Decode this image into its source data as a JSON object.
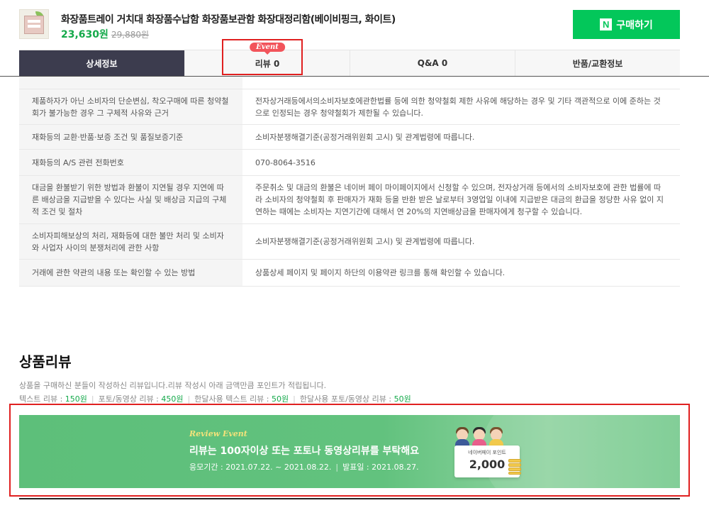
{
  "product": {
    "title": "화장품트레이 거치대 화장품수납함 화장품보관함 화장대정리함(베이비핑크, 화이트)",
    "price": "23,630원",
    "original_price": "29,880원",
    "buy_label": "구매하기",
    "buy_logo": "N"
  },
  "tabs": [
    {
      "label": "상세정보",
      "active": true
    },
    {
      "label": "리뷰 0",
      "badge": "Event"
    },
    {
      "label": "Q&A 0"
    },
    {
      "label": "반품/교환정보"
    }
  ],
  "info_rows": [
    {
      "key": "",
      "value": ""
    },
    {
      "key": "제품하자가 아닌 소비자의 단순변심, 착오구매에 따른 청약철회가 불가능한 경우 그 구체적 사유와 근거",
      "value": "전자상거래등에서의소비자보호에관한법률 등에 의한 청약철회 제한 사유에 해당하는 경우 및 기타 객관적으로 이에 준하는 것으로 인정되는 경우 청약철회가 제한될 수 있습니다."
    },
    {
      "key": "재화등의 교환·반품·보증 조건 및 품질보증기준",
      "value": "소비자분쟁해결기준(공정거래위원회 고시) 및 관계법령에 따릅니다."
    },
    {
      "key": "재화등의 A/S 관련 전화번호",
      "value": "070-8064-3516"
    },
    {
      "key": "대금을 환불받기 위한 방법과 환불이 지연될 경우 지연에 따른 배상금을 지급받을 수 있다는 사실 및 배상금 지급의 구체적 조건 및 절차",
      "value": "주문취소 및 대금의 환불은 네이버 페이 마이페이지에서 신청할 수 있으며, 전자상거래 등에서의 소비자보호에 관한 법률에 따라 소비자의 청약철회 후 판매자가 재화 등을 반환 받은 날로부터 3영업일 이내에 지급받은 대금의 환급을 정당한 사유 없이 지연하는 때에는 소비자는 지연기간에 대해서 연 20%의 지연배상금을 판매자에게 청구할 수 있습니다."
    },
    {
      "key": "소비자피해보상의 처리, 재화등에 대한 불만 처리 및 소비자와 사업자 사이의 분쟁처리에 관한 사항",
      "value": "소비자분쟁해결기준(공정거래위원회 고시) 및 관계법령에 따릅니다."
    },
    {
      "key": "거래에 관한 약관의 내용 또는 확인할 수 있는 방법",
      "value": "상품상세 페이지 및 페이지 하단의 이용약관 링크를 통해 확인할 수 있습니다."
    }
  ],
  "review": {
    "title": "상품리뷰",
    "description": "상품을 구매하신 분들이 작성하신 리뷰입니다.리뷰 작성시 아래 금액만큼 포인트가 적립됩니다.",
    "points": [
      {
        "label": "텍스트 리뷰 : ",
        "value": "150원"
      },
      {
        "label": "포토/동영상 리뷰 : ",
        "value": "450원"
      },
      {
        "label": "한달사용 텍스트 리뷰 : ",
        "value": "50원"
      },
      {
        "label": "한달사용 포토/동영상 리뷰 : ",
        "value": "50원"
      }
    ]
  },
  "banner": {
    "event_label": "Review Event",
    "headline": "리뷰는 100자이상 또는 포토나 동영상리뷰를 부탁해요",
    "period": "응모기간 : 2021.07.22. ~ 2021.08.22.",
    "announce": "발표일 : 2021.08.27.",
    "card_label": "네이버페이 포인트",
    "card_value": "2,000"
  },
  "colors": {
    "accent_green": "#03c75a",
    "price_green": "#14a94a",
    "active_tab": "#3c3c4e",
    "event_badge": "#f2545b",
    "highlight_red": "#e02020",
    "banner_green": "#62c27e"
  }
}
